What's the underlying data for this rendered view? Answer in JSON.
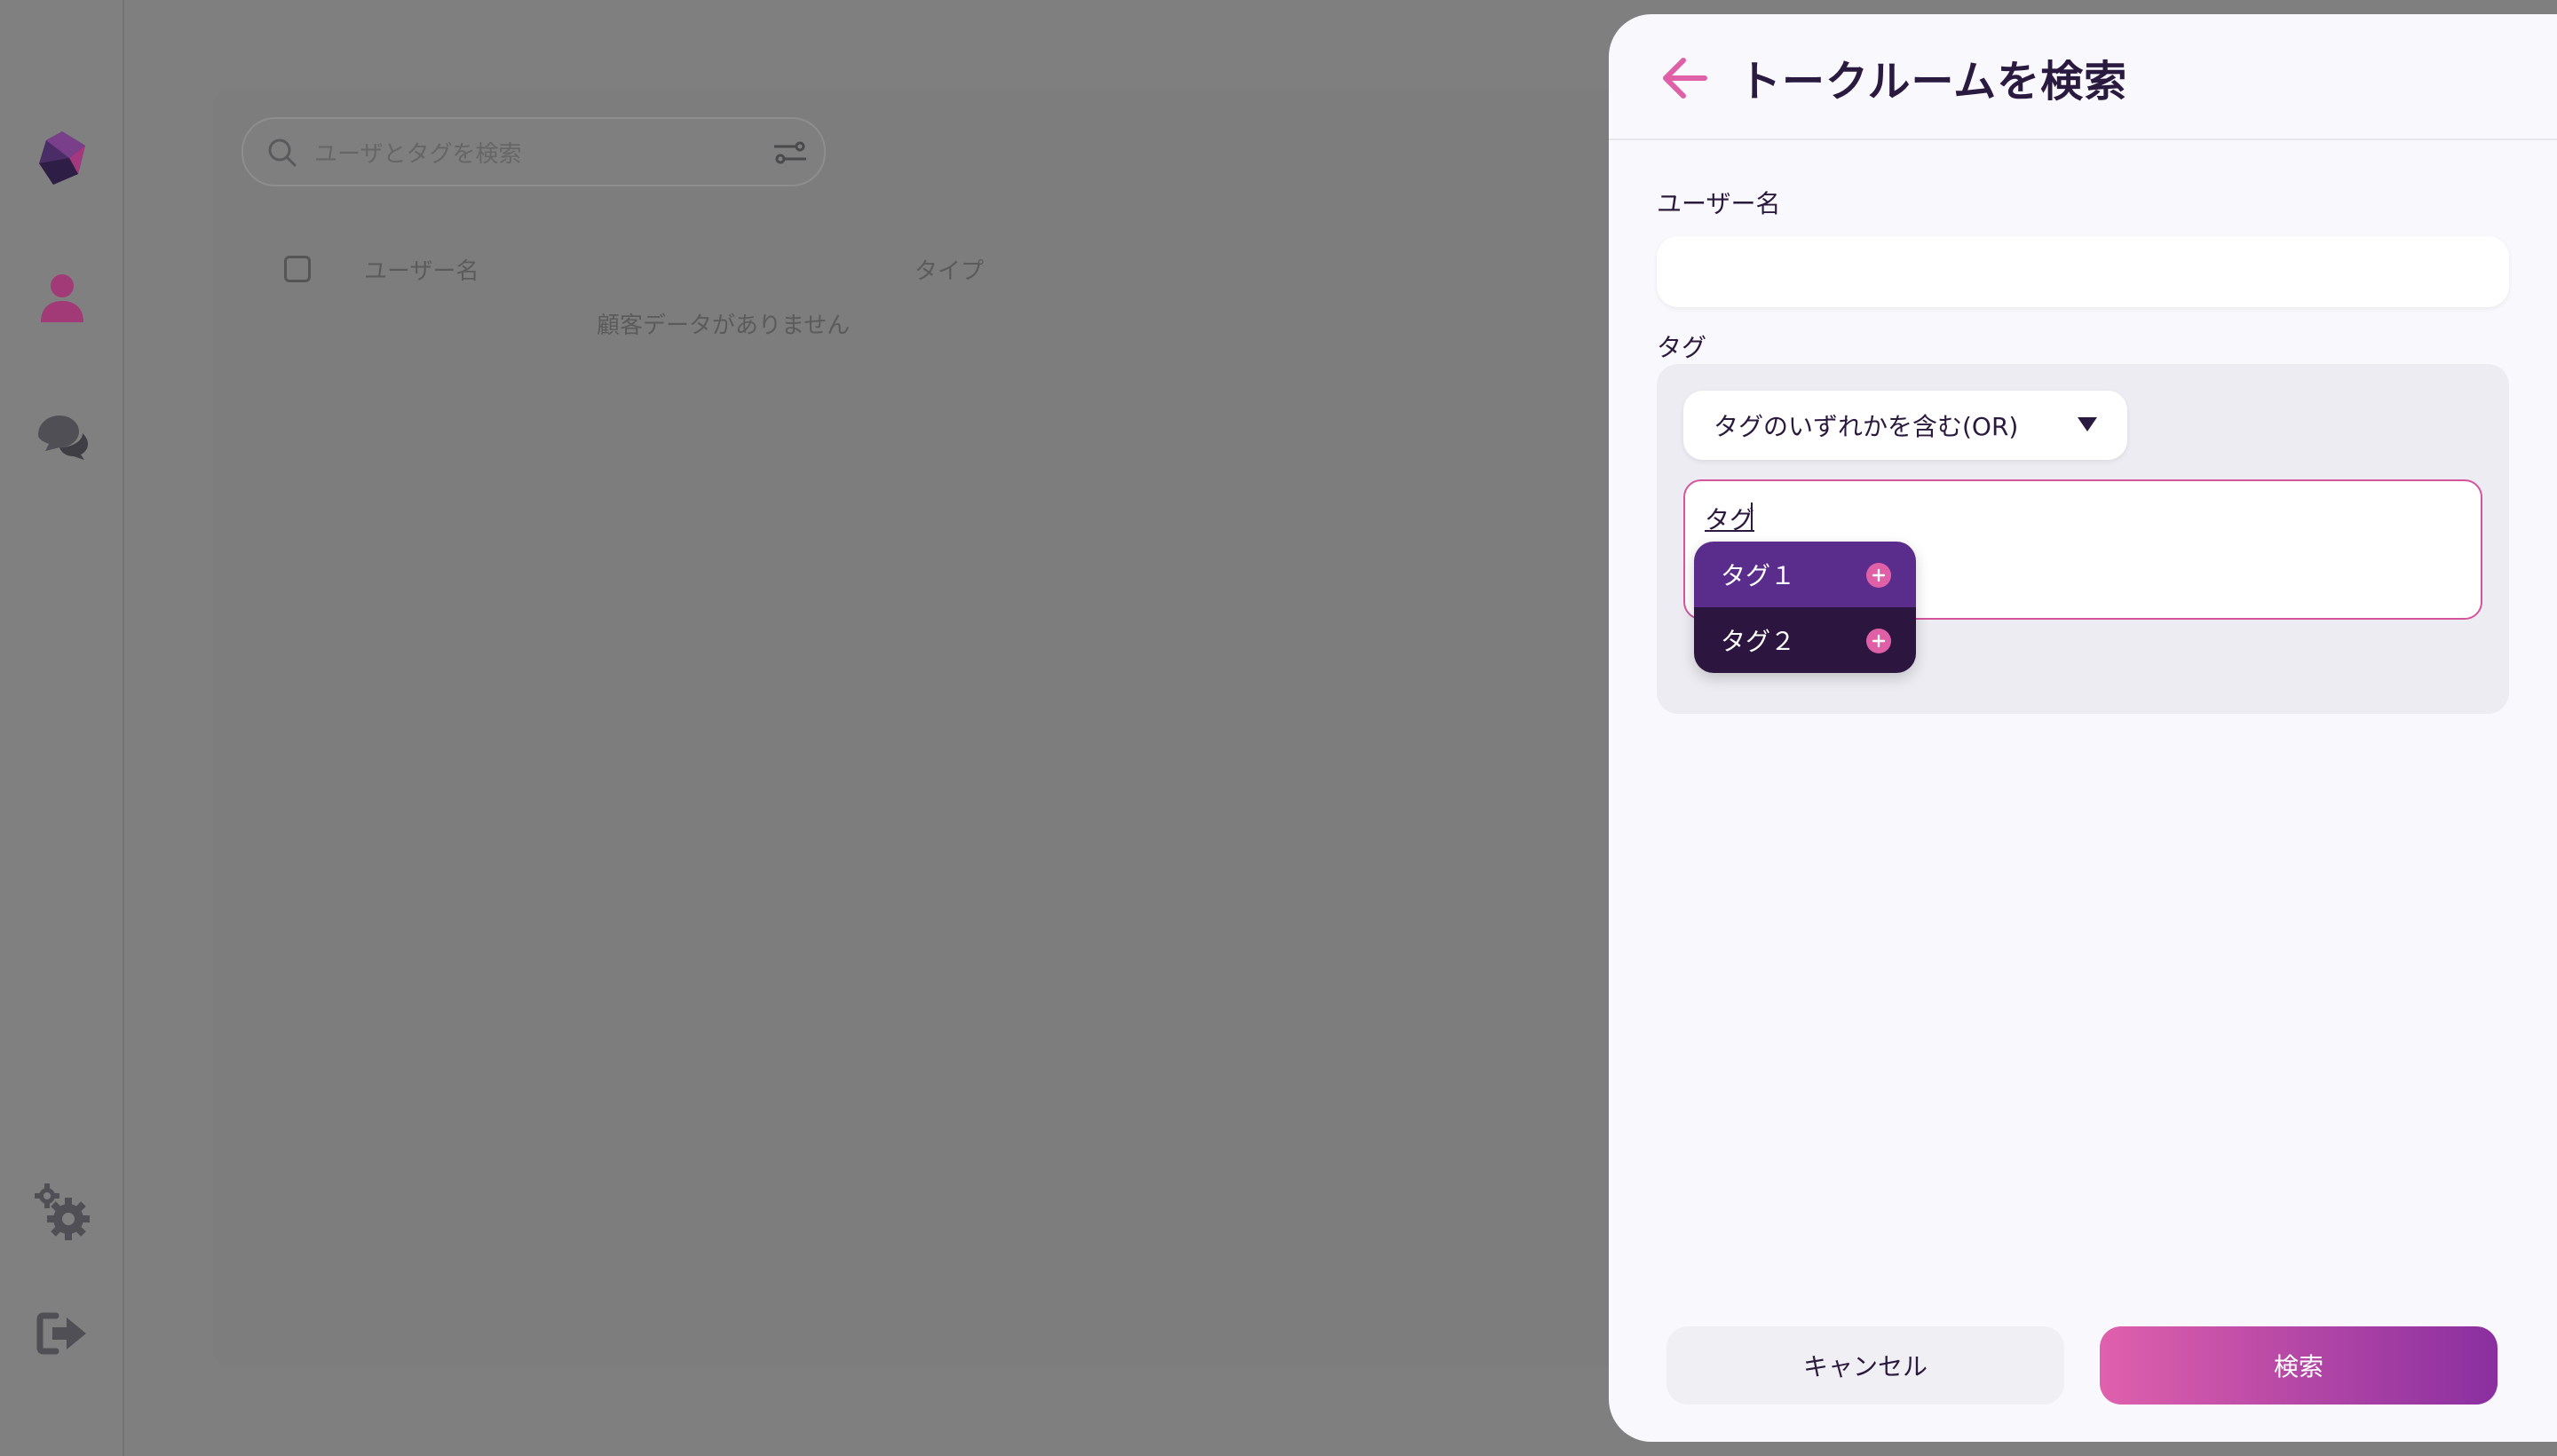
{
  "background": {
    "search_placeholder": "ユーザとタグを検索",
    "columns": [
      "ユーザー名",
      "タイプ"
    ],
    "empty_message": "顧客データがありません"
  },
  "panel": {
    "title": "トークルームを検索",
    "username_label": "ユーザー名",
    "username_value": "",
    "tag_label": "タグ",
    "tag_mode": "タグのいずれかを含む(OR)",
    "tag_typed": "タグ",
    "suggestions": [
      "タグ１",
      "タグ２"
    ],
    "cancel_label": "キャンセル",
    "search_label": "検索"
  },
  "colors": {
    "accent": "#e060a8",
    "dark": "#2a1a40",
    "purple": "#5a2d8c"
  },
  "icons": [
    "app-logo-icon",
    "user-icon",
    "chat-icon",
    "settings-icon",
    "logout-icon",
    "search-icon",
    "filter-icon",
    "back-arrow-icon",
    "plus-icon"
  ]
}
